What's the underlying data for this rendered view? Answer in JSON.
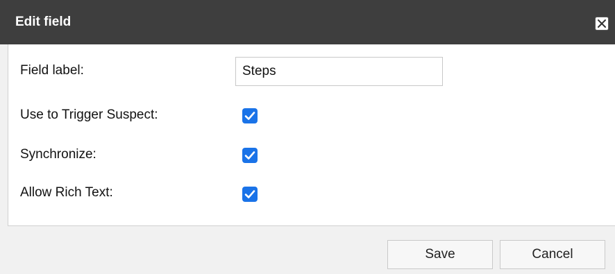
{
  "dialog": {
    "title": "Edit field",
    "close_icon": "close-x-icon"
  },
  "form": {
    "field_label": {
      "label": "Field label:",
      "value": "Steps"
    },
    "trigger_suspect": {
      "label": "Use to Trigger Suspect:",
      "checked": true
    },
    "synchronize": {
      "label": "Synchronize:",
      "checked": true
    },
    "allow_rich_text": {
      "label": "Allow Rich Text:",
      "checked": true
    }
  },
  "buttons": {
    "save_label": "Save",
    "cancel_label": "Cancel"
  },
  "colors": {
    "titlebar": "#3e3e3e",
    "checkbox": "#1a73e8",
    "background": "#f1f1f1"
  }
}
